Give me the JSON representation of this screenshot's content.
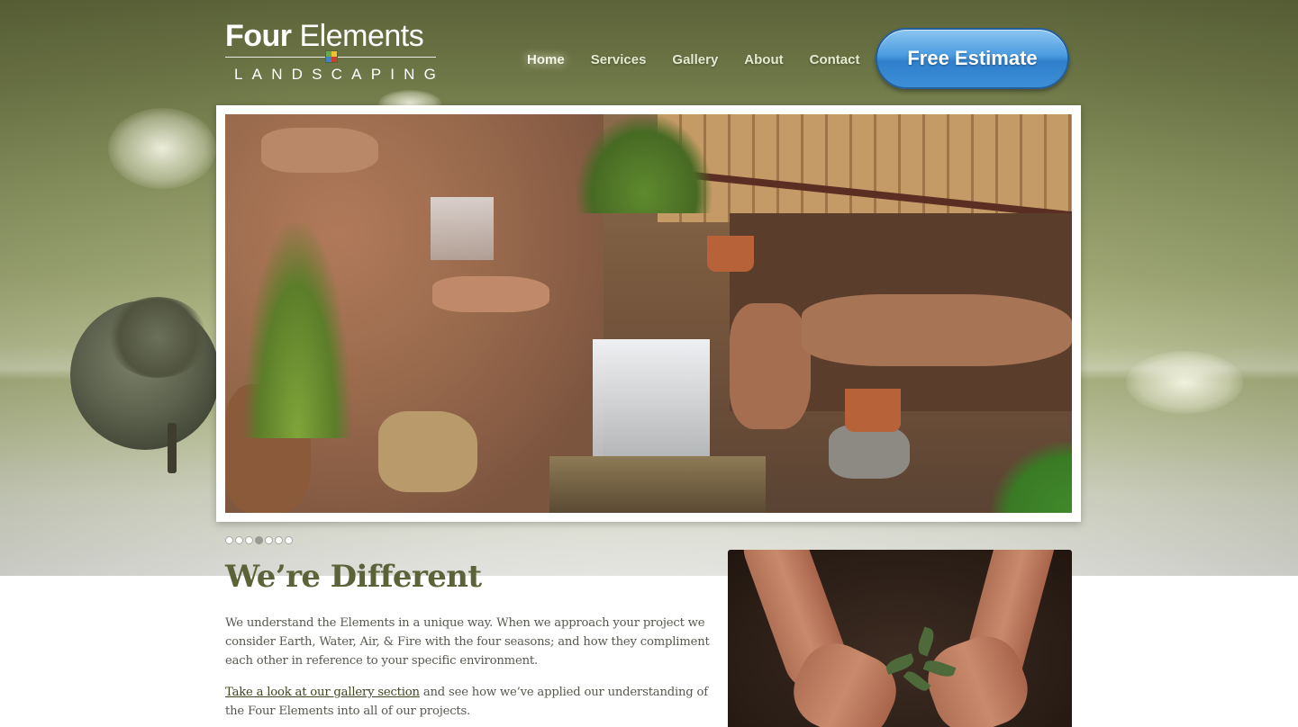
{
  "logo": {
    "word1": "Four",
    "word2": "Elements",
    "subtitle": "LANDSCAPING",
    "square_colors": [
      "#6aa84f",
      "#f1c232",
      "#3d85c6",
      "#cc4125"
    ]
  },
  "nav": {
    "items": [
      "Home",
      "Services",
      "Gallery",
      "About",
      "Contact"
    ],
    "active": "Home"
  },
  "cta": {
    "label": "Free Estimate"
  },
  "slider": {
    "total_slides": 7,
    "current_slide": 4
  },
  "content": {
    "heading": "We’re Different",
    "paragraph1": "We understand the Elements in a unique way. When we approach your project we consider Earth, Water, Air, & Fire with the four seasons; and how they compliment each other in reference to your specific environment.",
    "gallery_link": "Take a look at our gallery section",
    "paragraph2_rest": " and see how we’ve applied our understanding of the Four Elements into all of our projects."
  },
  "colors": {
    "brand_olive": "#5c6339",
    "cta_blue": "#3d8fd8",
    "nav_text": "#e4ead0"
  }
}
